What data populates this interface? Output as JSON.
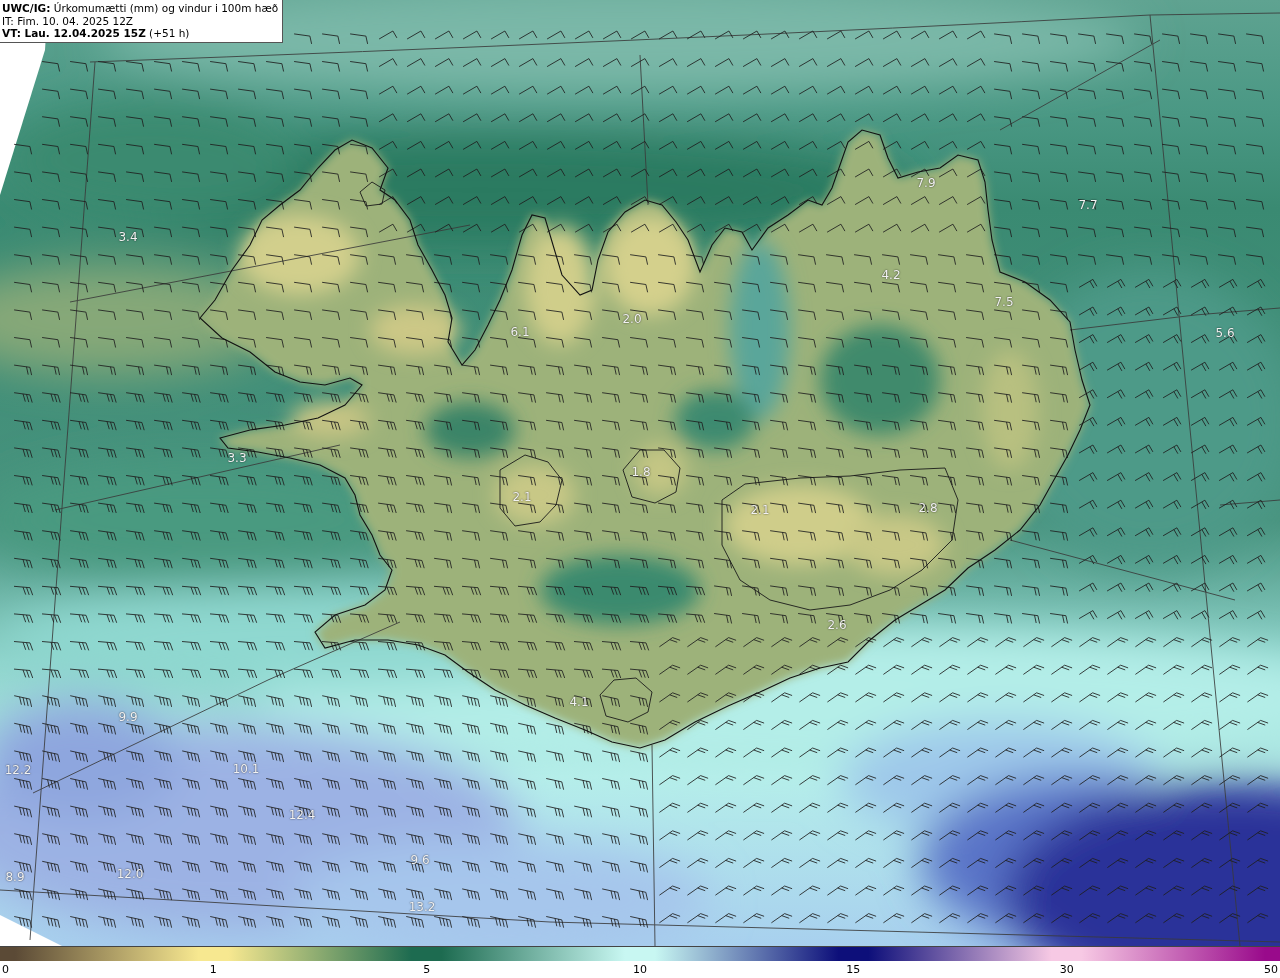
{
  "header": {
    "title": "**UWC/IG:** Úrkomumætti (mm) og vindur i 100m hæð",
    "issued": "IT: Fim. 10. 04. 2025 12Z",
    "valid": "**VT: Lau. 12.04.2025 15Z** (+51 h)"
  },
  "map": {
    "value_labels": [
      "7.9",
      "7.7",
      "3.4",
      "4.2",
      "7.5",
      "2.0",
      "6.1",
      "5.6",
      "3.3",
      "1.8",
      "2.1",
      "2.1",
      "2.8",
      "2.6",
      "4.1",
      "9.9",
      "10.1",
      "12.2",
      "12.4",
      "9.6",
      "12.0",
      "8.9",
      "13.2"
    ]
  },
  "colorbar": {
    "ticks": [
      {
        "label": "0",
        "color": "#5b4a36"
      },
      {
        "label": "1",
        "color": "#f7e890"
      },
      {
        "label": "5",
        "color": "#1d6b50"
      },
      {
        "label": "10",
        "color": "#c8f7f2"
      },
      {
        "label": "15",
        "color": "#0d0f7a"
      },
      {
        "label": "30",
        "color": "#f7c9e4"
      },
      {
        "label": "50",
        "color": "#990a8b"
      }
    ]
  }
}
